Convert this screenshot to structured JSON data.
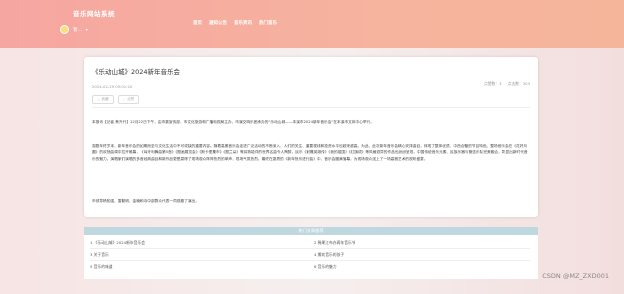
{
  "header": {
    "site_title": "音乐网站系统",
    "user_name": "管...",
    "user_caret": "▾",
    "nav": [
      "首页",
      "通知公告",
      "音乐资讯",
      "热门音乐"
    ]
  },
  "article": {
    "title": "《乐动山城》2024新年音乐会",
    "time": "2024-02-29 05:01:20",
    "stats": [
      "点赞数：3",
      "点击数：303"
    ],
    "buttons": [
      {
        "label": "收藏",
        "icon": "star-icon"
      },
      {
        "label": "点赞",
        "icon": "thumbs-up-icon"
      }
    ],
    "paragraphs": [
      "本报讯【记者 蔡升升】12月22日下午，由市委宣传部、市文化旅游和广播电视局主办，市演交响乐团承办的“乐动山城——本溪市2024新年音乐会”在本溪市文体中心举行。",
      "观剧年终岁末，新年音乐会的如期而至与文化生活中不可或缺的重要内容。随着高雅音乐会走进广泛活动的不断深入，人们的关注、重要视线和投资水平也越来越高。为此，此次新年音乐会精心安排曲目，体现了整体优质、中西合璧的节目特色。整场音乐会在《花好月圆》的欢快曲调中拉开帷幕，《匈牙利舞曲第5首》《图画展览会》《斯卡堡集市》《图兰朵》等耳熟能详的世界名曲令人陶醉，民乐《射雕英雄传》《我的祖国》《红旗颂》等风格迥异的作品也纷纷呈现，中国传统音乐元素、民族乐器与管弦乐队完美融合，彰显出新时代音乐的魅力。演唱家们演唱的多首经典曲目和新作品更是赢得了现场观众阵阵热烈的掌声，现场气氛热烈。最终在激昂的《新年快乐进行曲》中，音乐会圆满落幕，为现场观众送上了一场高雅艺术的视听盛宴。",
      "市领导杨知强、富勤明、金楠和寺中部群众代表一同观看了演出。"
    ]
  },
  "related": {
    "header": "热门文章推荐",
    "items": [
      "1 《乐动山城》2024新年音乐会",
      "2 稀果江布办两年音乐节",
      "3 关于音乐",
      "4 撕欢音乐的孩子",
      "5 音乐的味道",
      "6 音乐的魅力"
    ]
  },
  "watermark": "CSDN @MZ_ZXD001",
  "colors": {
    "topbar": "#f6a6a1",
    "related_header": "#bfd7df"
  }
}
